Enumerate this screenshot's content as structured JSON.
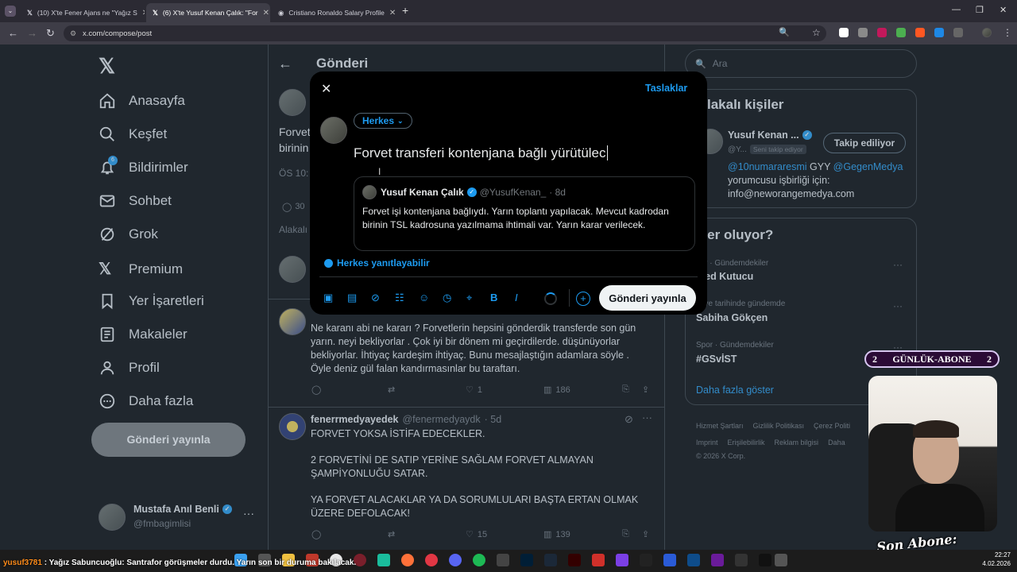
{
  "browser": {
    "tabs": [
      {
        "label": "(10) X'te Fener Ajans ne \"Yağız S"
      },
      {
        "label": "(6) X'te Yusuf Kenan Çalık: \"For"
      },
      {
        "label": "Cristiano Ronaldo Salary Profile"
      }
    ],
    "url": "x.com/compose/post"
  },
  "sidebar": {
    "items": [
      {
        "label": "Anasayfa"
      },
      {
        "label": "Keşfet"
      },
      {
        "label": "Bildirimler",
        "badge": "6"
      },
      {
        "label": "Sohbet"
      },
      {
        "label": "Grok"
      },
      {
        "label": "Premium"
      },
      {
        "label": "Yer İşaretleri"
      },
      {
        "label": "Makaleler"
      },
      {
        "label": "Profil"
      },
      {
        "label": "Daha fazla"
      }
    ],
    "post_button": "Gönderi yayınla",
    "account": {
      "name": "Mustafa Anıl Benli",
      "handle": "@fmbagimlisi"
    }
  },
  "main": {
    "title": "Gönderi",
    "peek": {
      "line1": "Forvet",
      "line2": "birinin",
      "time": "ÖS 10:",
      "replies": "30",
      "related": "Alakalı"
    },
    "reply1": {
      "text": "Ne karanı abi ne kararı ? Forvetlerin hepsini gönderdik transferde son gün yarın.  neyi bekliyorlar . Çok iyi bir dönem mi geçirdilerde. düşünüyorlar bekliyorlar. İhtiyaç kardeşim ihtiyaç. Bunu mesajlaştığın adamlara söyle . Öyle deniz gül falan kandırmasınlar bu taraftarı.",
      "likes": "1",
      "views": "186"
    },
    "reply2": {
      "name": "fenerrmedyayedek",
      "handle": "@fenermedyaydk",
      "age": "· 5d",
      "line1": "FORVET YOKSA İSTİFA EDECEKLER.",
      "line2": "2 FORVETİNİ DE SATIP YERİNE SAĞLAM FORVET ALMAYAN ŞAMPİYONLUĞU SATAR.",
      "line3": "YA FORVET ALACAKLAR YA DA SORUMLULARI BAŞTA ERTAN OLMAK ÜZERE DEFOLACAK!",
      "likes": "15",
      "views": "139"
    }
  },
  "modal": {
    "drafts": "Taslaklar",
    "audience": "Herkes",
    "text": "Forvet transferi kontenjana bağlı yürütülec",
    "quote": {
      "name": "Yusuf Kenan Çalık",
      "handle": "@YusufKenan_",
      "age": "· 8d",
      "text": "Forvet işi kontenjana bağlıydı. Yarın toplantı yapılacak. Mevcut kadrodan birinin TSL kadrosuna yazılmama ihtimali var. Yarın karar verilecek."
    },
    "reply_setting": "Herkes yanıtlayabilir",
    "submit": "Gönderi yayınla"
  },
  "right": {
    "search_placeholder": "Ara",
    "related_title": "lakalı kişiler",
    "person": {
      "name": "Yusuf Kenan ...",
      "handle": "@Y...",
      "follows_you": "Seni takip ediyor",
      "follow_btn": "Takip ediliyor",
      "bio_mention1": "@10numararesmi",
      "bio_word": "GYY",
      "bio_mention2": "@GegenMedya",
      "bio_line2": "yorumcusu işbirliği için:",
      "bio_line3": "info@neworangemedya.com"
    },
    "trends_title": "eler oluyor?",
    "trends": [
      {
        "meta": "por · Gündemdekiler",
        "name": "med Kutucu"
      },
      {
        "meta": "rkiye tarihinde gündemde",
        "name": "Sabiha Gökçen"
      },
      {
        "meta": "Spor · Gündemdekiler",
        "name": "#GSvİST"
      }
    ],
    "show_more": "Daha fazla göster",
    "footer1": [
      "Hizmet Şartları",
      "Gizlilik Politikası",
      "Çerez Politi"
    ],
    "footer2": [
      "Imprint",
      "Erişilebilirlik",
      "Reklam bilgisi",
      "Daha"
    ],
    "copyright": "© 2026 X Corp."
  },
  "overlay": {
    "gabone_left": "2",
    "gabone_label": "GÜNLÜK-ABONE",
    "gabone_right": "2",
    "son_abone": "Son Abone: cemgonte",
    "ticker_user": "yusuf3781",
    "ticker_msg": " : Yağız Sabuncuoğlu: Santrafor görüşmeler durdu. Yarın son bir duruma bakılacak."
  },
  "taskbar": {
    "time": "22:27",
    "date": "4.02.2026"
  }
}
